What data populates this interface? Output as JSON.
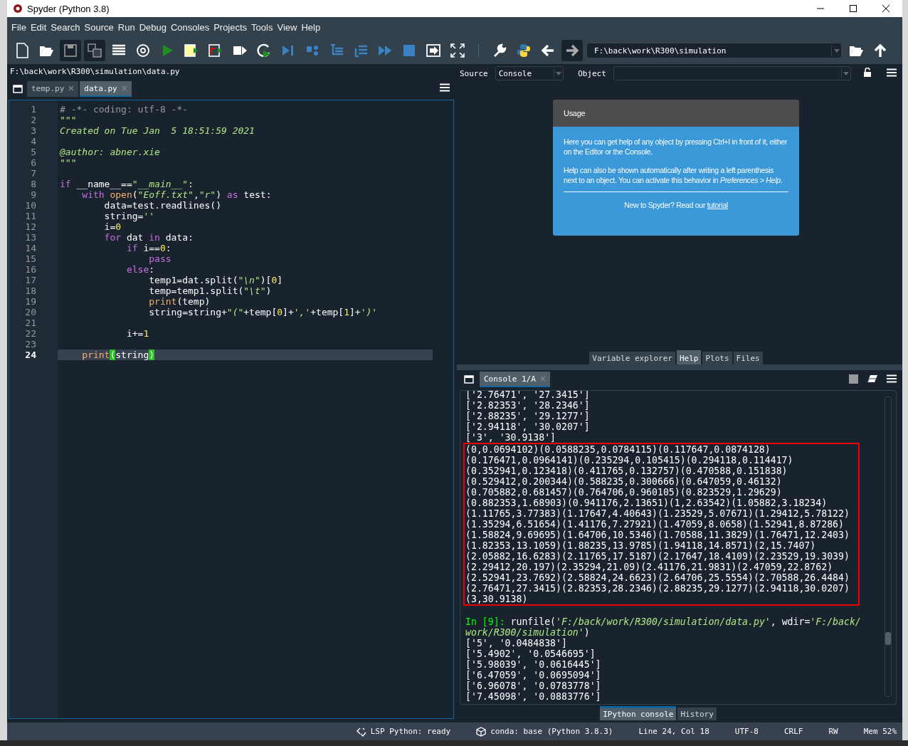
{
  "window": {
    "title": "Spyder (Python 3.8)"
  },
  "menu": [
    "File",
    "Edit",
    "Search",
    "Source",
    "Run",
    "Debug",
    "Consoles",
    "Projects",
    "Tools",
    "View",
    "Help"
  ],
  "toolbar": {
    "path": "F:\\back\\work\\R300\\simulation"
  },
  "editor": {
    "file_path": "F:\\back\\work\\R300\\simulation\\data.py",
    "tabs": [
      {
        "label": "temp.py",
        "selected": false
      },
      {
        "label": "data.py",
        "selected": true
      }
    ],
    "lines": [
      {
        "number": "1",
        "current": false,
        "tokens": [
          {
            "kind": "comment",
            "text": "# -*- coding: utf-8 -*-"
          }
        ]
      },
      {
        "number": "2",
        "current": false,
        "tokens": [
          {
            "kind": "docstring",
            "text": "\"\"\""
          }
        ]
      },
      {
        "number": "3",
        "current": false,
        "tokens": [
          {
            "kind": "docstring",
            "text": "Created on Tue Jan  5 18:51:59 2021"
          }
        ]
      },
      {
        "number": "4",
        "current": false
      },
      {
        "number": "5",
        "current": false,
        "tokens": [
          {
            "kind": "docstring",
            "text": "@author: abner.xie"
          }
        ]
      },
      {
        "number": "6",
        "current": false,
        "tokens": [
          {
            "kind": "docstring",
            "text": "\"\"\""
          }
        ]
      },
      {
        "number": "7",
        "current": false
      },
      {
        "number": "8",
        "current": false,
        "tokens": [
          {
            "kind": "keyword",
            "text": "if"
          },
          {
            "kind": "plain",
            "text": " __name__=="
          },
          {
            "kind": "string",
            "text": "\"__main__\""
          },
          {
            "kind": "plain",
            "text": ":"
          }
        ]
      },
      {
        "number": "9",
        "current": false,
        "tokens": [
          {
            "kind": "keyword",
            "text": "    with "
          },
          {
            "kind": "builtin",
            "text": "open"
          },
          {
            "kind": "plain",
            "text": "("
          },
          {
            "kind": "string",
            "text": "\"Eoff.txt\""
          },
          {
            "kind": "plain",
            "text": ","
          },
          {
            "kind": "string",
            "text": "\"r\""
          },
          {
            "kind": "plain",
            "text": ") "
          },
          {
            "kind": "keyword",
            "text": "as"
          },
          {
            "kind": "plain",
            "text": " test:"
          }
        ]
      },
      {
        "number": "10",
        "current": false,
        "tokens": [
          {
            "kind": "plain",
            "text": "        data=test.readlines()"
          }
        ]
      },
      {
        "number": "11",
        "current": false,
        "tokens": [
          {
            "kind": "plain",
            "text": "        string="
          },
          {
            "kind": "string",
            "text": "''"
          }
        ]
      },
      {
        "number": "12",
        "current": false,
        "tokens": [
          {
            "kind": "plain",
            "text": "        i="
          },
          {
            "kind": "number",
            "text": "0"
          }
        ]
      },
      {
        "number": "13",
        "current": false,
        "tokens": [
          {
            "kind": "keyword",
            "text": "        for"
          },
          {
            "kind": "plain",
            "text": " dat "
          },
          {
            "kind": "keyword",
            "text": "in"
          },
          {
            "kind": "plain",
            "text": " data:"
          }
        ]
      },
      {
        "number": "14",
        "current": false,
        "tokens": [
          {
            "kind": "keyword",
            "text": "            if"
          },
          {
            "kind": "plain",
            "text": " i=="
          },
          {
            "kind": "number",
            "text": "0"
          },
          {
            "kind": "plain",
            "text": ":"
          }
        ]
      },
      {
        "number": "15",
        "current": false,
        "tokens": [
          {
            "kind": "keyword",
            "text": "                pass"
          }
        ]
      },
      {
        "number": "16",
        "current": false,
        "tokens": [
          {
            "kind": "keyword",
            "text": "            else"
          },
          {
            "kind": "plain",
            "text": ":"
          }
        ]
      },
      {
        "number": "17",
        "current": false,
        "tokens": [
          {
            "kind": "plain",
            "text": "                temp1=dat.split("
          },
          {
            "kind": "string",
            "text": "\"\\n\""
          },
          {
            "kind": "plain",
            "text": ")["
          },
          {
            "kind": "number",
            "text": "0"
          },
          {
            "kind": "plain",
            "text": "]"
          }
        ]
      },
      {
        "number": "18",
        "current": false,
        "tokens": [
          {
            "kind": "plain",
            "text": "                temp=temp1.split("
          },
          {
            "kind": "string",
            "text": "\"\\t\""
          },
          {
            "kind": "plain",
            "text": ")"
          }
        ]
      },
      {
        "number": "19",
        "current": false,
        "tokens": [
          {
            "kind": "builtin",
            "text": "                print"
          },
          {
            "kind": "plain",
            "text": "(temp)"
          }
        ]
      },
      {
        "number": "20",
        "current": false,
        "tokens": [
          {
            "kind": "plain",
            "text": "                string=string+"
          },
          {
            "kind": "string",
            "text": "\"(\""
          },
          {
            "kind": "plain",
            "text": "+temp["
          },
          {
            "kind": "number",
            "text": "0"
          },
          {
            "kind": "plain",
            "text": "]+"
          },
          {
            "kind": "string",
            "text": "','"
          },
          {
            "kind": "plain",
            "text": "+temp["
          },
          {
            "kind": "number",
            "text": "1"
          },
          {
            "kind": "plain",
            "text": "]+"
          },
          {
            "kind": "string",
            "text": "')'"
          }
        ]
      },
      {
        "number": "21",
        "current": false
      },
      {
        "number": "22",
        "current": false,
        "tokens": [
          {
            "kind": "plain",
            "text": "            i+="
          },
          {
            "kind": "number",
            "text": "1"
          }
        ]
      },
      {
        "number": "23",
        "current": false
      },
      {
        "number": "24",
        "current": true,
        "tokens": [
          {
            "kind": "builtin",
            "text": "    print"
          },
          {
            "kind": "match",
            "text": "("
          },
          {
            "kind": "plain",
            "text": "string"
          },
          {
            "kind": "match",
            "text": ")"
          }
        ]
      }
    ]
  },
  "help": {
    "source_label": "Source",
    "source_value": "Console",
    "object_label": "Object",
    "card": {
      "title": "Usage",
      "paragraphs": [
        "Here you can get help of any object by pressing Ctrl+I in front of it, either on the Editor or the Console.",
        "Help can also be shown automatically after writing a left parenthesis next to an object. You can activate this behavior in *Preferences > Help*."
      ],
      "footer": "New to Spyder? Read our",
      "link": "tutorial"
    },
    "tabs": [
      {
        "label": "Variable explorer",
        "selected": false
      },
      {
        "label": "Help",
        "selected": true
      },
      {
        "label": "Plots",
        "selected": false
      },
      {
        "label": "Files",
        "selected": false
      }
    ]
  },
  "console": {
    "tabs": [
      {
        "label": "Console 1/A",
        "selected": true
      }
    ],
    "output_before": [
      "['2.76471', '27.3415']",
      "['2.82353', '28.2346']",
      "['2.88235', '29.1277']",
      "['2.94118', '30.0207']",
      "['3', '30.9138']"
    ],
    "marked_output": [
      "(0,0.0694102)(0.0588235,0.0784115)(0.117647,0.0874128)",
      "(0.176471,0.0964141)(0.235294,0.105415)(0.294118,0.114417)",
      "(0.352941,0.123418)(0.411765,0.132757)(0.470588,0.151838)",
      "(0.529412,0.200344)(0.588235,0.300666)(0.647059,0.46132)",
      "(0.705882,0.681457)(0.764706,0.960105)(0.823529,1.29629)",
      "(0.882353,1.68903)(0.941176,2.13651)(1,2.63542)(1.05882,3.18234)",
      "(1.11765,3.77383)(1.17647,4.40643)(1.23529,5.07671)(1.29412,5.78122)",
      "(1.35294,6.51654)(1.41176,7.27921)(1.47059,8.0658)(1.52941,8.87286)",
      "(1.58824,9.69695)(1.64706,10.5346)(1.70588,11.3829)(1.76471,12.2403)",
      "(1.82353,13.1059)(1.88235,13.9785)(1.94118,14.8571)(2,15.7407)",
      "(2.05882,16.6283)(2.11765,17.5187)(2.17647,18.4109)(2.23529,19.3039)",
      "(2.29412,20.197)(2.35294,21.09)(2.41176,21.9831)(2.47059,22.8762)",
      "(2.52941,23.7692)(2.58824,24.6623)(2.64706,25.5554)(2.70588,26.4484)",
      "(2.76471,27.3415)(2.82353,28.2346)(2.88235,29.1277)(2.94118,30.0207)",
      "(3,30.9138)"
    ],
    "prompt": [
      {
        "kind": "prompt",
        "text": "In [9]: "
      },
      {
        "kind": "plain",
        "text": "runfile("
      },
      {
        "kind": "string",
        "text": "'F:/back/work/R300/simulation/data.py'"
      },
      {
        "kind": "plain",
        "text": ", wdir="
      },
      {
        "kind": "string",
        "text": "'F:/back/work/R300/simulation'"
      },
      {
        "kind": "plain",
        "text": ")"
      }
    ],
    "output_after": [
      "['5', '0.0484838']",
      "['5.4902', '0.0546695']",
      "['5.98039', '0.0616445']",
      "['6.47059', '0.0695094']",
      "['6.96078', '0.0783778']",
      "['7.45098', '0.0883776']"
    ],
    "bottom_tabs": [
      {
        "label": "IPython console",
        "selected": true
      },
      {
        "label": "History",
        "selected": false
      }
    ]
  },
  "status_bar": [
    {
      "kind": "lsp",
      "text": "LSP Python: ready"
    },
    {
      "kind": "conda",
      "text": "conda: base (Python 3.8.3)"
    },
    {
      "kind": "plain",
      "text": "Line 24, Col 18"
    },
    {
      "kind": "plain",
      "text": "UTF-8"
    },
    {
      "kind": "plain",
      "text": "CRLF"
    },
    {
      "kind": "plain",
      "text": "RW"
    },
    {
      "kind": "plain",
      "text": "Mem 52%"
    }
  ]
}
